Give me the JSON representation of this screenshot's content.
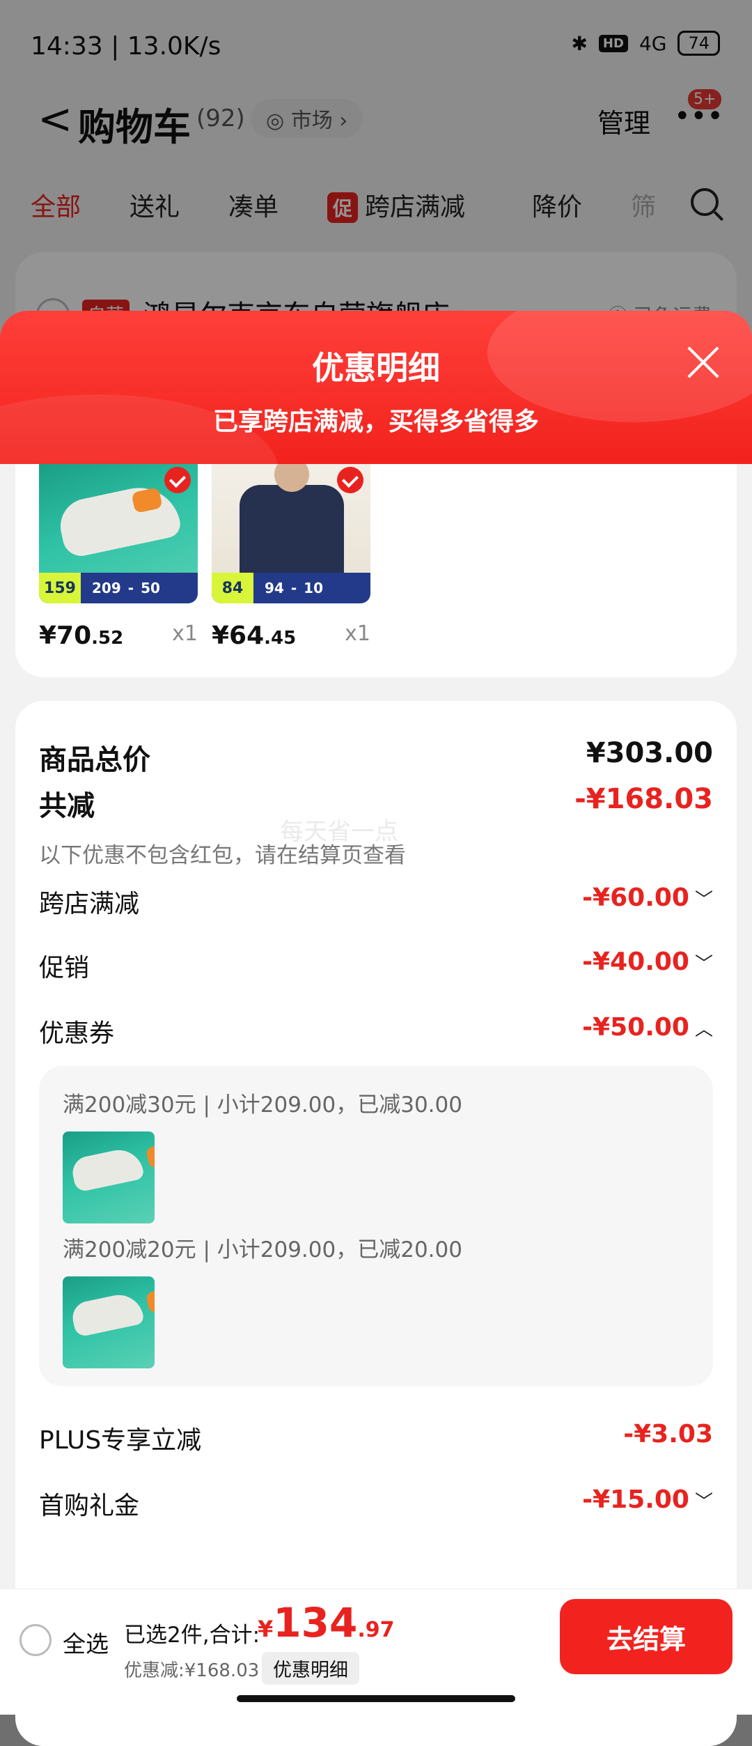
{
  "status": {
    "time_speed": "14:33 | 13.0K/s",
    "hd": "HD",
    "network": "4G",
    "battery": "74"
  },
  "header": {
    "back": "<",
    "title": "购物车",
    "count": "(92)",
    "market": "◎ 市场 ›",
    "manage": "管理",
    "more": "•••",
    "badge": "5+"
  },
  "tabs": {
    "all": "全部",
    "gift": "送礼",
    "combine": "凑单",
    "promo_tag": "促",
    "cross_store": "跨店满减",
    "price_drop": "降价",
    "filter": "筛"
  },
  "store": {
    "tag": "自营",
    "name": "鸿星尔克京东自营旗舰店 ›",
    "shipping": "ⓘ 已免运费"
  },
  "sheet": {
    "title": "优惠明细",
    "subtitle": "已享跨店满减，买得多省得多"
  },
  "products": [
    {
      "price_int": "¥70",
      "price_dec": ".52",
      "qty": "x1",
      "badge_low": "159",
      "badge_a": "209",
      "badge_b": "50"
    },
    {
      "price_int": "¥64",
      "price_dec": ".45",
      "qty": "x1",
      "badge_low": "84",
      "badge_a": "94",
      "badge_b": "10"
    }
  ],
  "details": {
    "total_label": "商品总价",
    "total_value": "¥303.00",
    "reduce_label": "共减",
    "reduce_value": "-¥168.03",
    "watermark": "每天省一点",
    "note": "以下优惠不包含红包，请在结算页查看",
    "cross_label": "跨店满减",
    "cross_value": "-¥60.00",
    "promo_label": "促销",
    "promo_value": "-¥40.00",
    "coupon_label": "优惠券",
    "coupon_value": "-¥50.00",
    "coupon1": "满200减30元 | 小计209.00，已减30.00",
    "coupon2": "满200减20元 | 小计209.00，已减20.00",
    "plus_label": "PLUS专享立减",
    "plus_value": "-¥3.03",
    "first_label": "首购礼金",
    "first_value": "-¥15.00",
    "chev_down": "﹀",
    "chev_up": "︿"
  },
  "bottom": {
    "select_all": "全选",
    "summary": "已选2件,合计:",
    "currency": "¥",
    "total_int": "134",
    "total_dec": ".97",
    "discount": "优惠减:¥168.03",
    "detail_button": "优惠明细",
    "checkout": "去结算"
  },
  "colors": {
    "accent": "#e8231f",
    "sheet_top": "#f2221d",
    "dim": "rgba(0,0,0,0.42)"
  }
}
